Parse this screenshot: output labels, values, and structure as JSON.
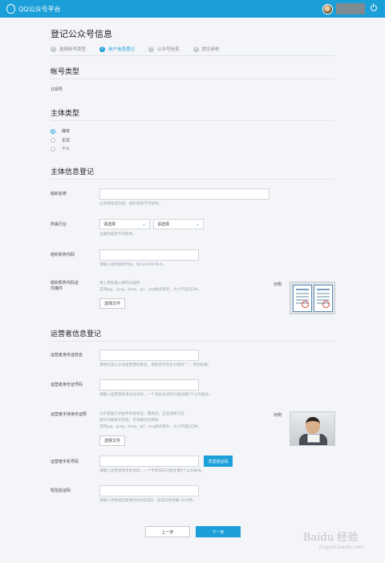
{
  "header": {
    "brand": "QQ公众号平台"
  },
  "page": {
    "title": "登记公众号信息"
  },
  "steps": [
    {
      "num": "1",
      "label": "选择帐号类型"
    },
    {
      "num": "2",
      "label": "用户信息登记"
    },
    {
      "num": "3",
      "label": "公众号信息"
    },
    {
      "num": "4",
      "label": "提交审核"
    }
  ],
  "account_type": {
    "title": "帐号类型",
    "value": "订阅号"
  },
  "subject_type": {
    "title": "主体类型",
    "options": [
      {
        "label": "媒体",
        "checked": true
      },
      {
        "label": "企业",
        "checked": false
      },
      {
        "label": "个人",
        "checked": false
      }
    ]
  },
  "subject_info": {
    "title": "主体信息登记",
    "org_name": {
      "label": "组织名称",
      "hint": "信息审核成功后，组织名称不可修改。"
    },
    "industry": {
      "label": "所属行业",
      "select1": "请选择",
      "select2": "请选择",
      "hint": "注册完成后不可修改。"
    },
    "org_code": {
      "label": "组织机构代码",
      "hint": "请输入组织机构代码，如12345678-9。"
    },
    "org_scan": {
      "label_line1": "组织机构代码证",
      "label_line2": "扫描件",
      "hint_line1": "请上传加盖公章的扫描件",
      "hint_line2": "支持jpg、jpeg、bmp、gif、png格式照片，大小不超过2M。",
      "button": "选择文件",
      "example_label": "示例"
    }
  },
  "operator_info": {
    "title": "运营者信息登记",
    "name": {
      "label": "运营者身份证姓名",
      "hint": "请填写该公众号运营者的姓名，如果名字包含分隔号“·”，请勿省略。"
    },
    "id_number": {
      "label": "运营者身份证号码",
      "hint": "请输入运营者的身份证号码，一个身份证号码只能注册5个公众帐号。"
    },
    "id_photo": {
      "label": "运营者手持身份证照",
      "hint_line1": "以示意图方式拍手持身份证，需免冠，五官清晰可见",
      "hint_line2": "照片内容真实有效，不得做任何修改",
      "hint_line3": "支持jpg、jpeg、bmp、gif、png格式照片，大小不超过2M。",
      "button": "选择文件",
      "example_label": "示例"
    },
    "phone": {
      "label": "运营者手机号码",
      "button": "发送验证码",
      "hint": "请输入运营者的手机号码，一个手机号码只能注册5个公众帐号。"
    },
    "sms_code": {
      "label": "短信验证码",
      "hint": "请输入手机短信收到的6位验证码，验证码有效期 10分钟。"
    }
  },
  "footer": {
    "prev": "上一步",
    "next": "下一步"
  },
  "watermark": {
    "main": "Baidu 经验",
    "sub": "jingyan.baidu.com"
  },
  "colors": {
    "accent": "#1a9fd8",
    "background": "#f4f5f9"
  }
}
